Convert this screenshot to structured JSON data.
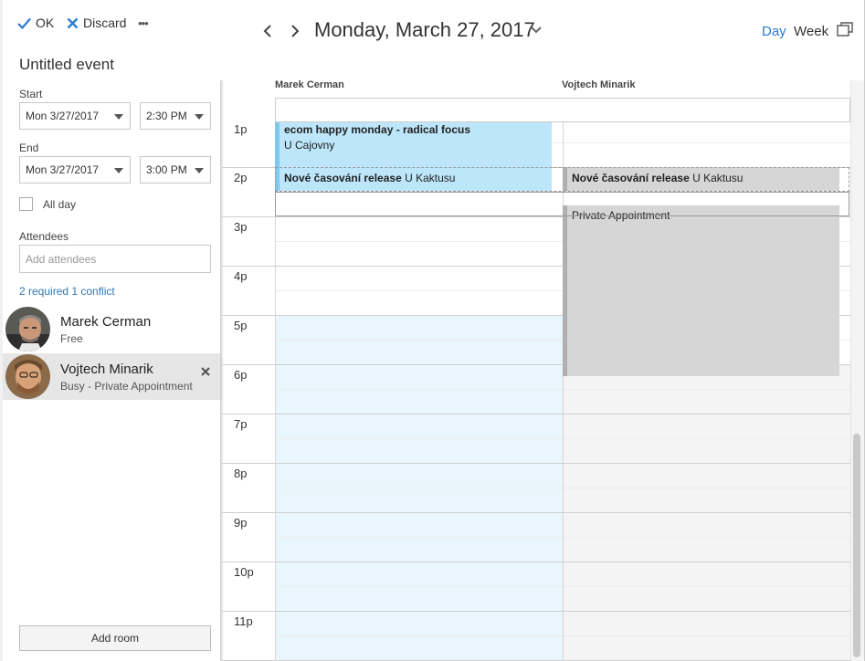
{
  "toolbar": {
    "ok_label": "OK",
    "discard_label": "Discard",
    "more_label": "•••"
  },
  "event": {
    "title": "Untitled event",
    "start_label": "Start",
    "start_date": "Mon 3/27/2017",
    "start_time": "2:30 PM",
    "end_label": "End",
    "end_date": "Mon 3/27/2017",
    "end_time": "3:00 PM",
    "allday_label": "All day"
  },
  "attendees": {
    "label": "Attendees",
    "placeholder": "Add attendees",
    "summary": "2 required 1 conflict",
    "people": [
      {
        "name": "Marek Cerman",
        "status": "Free"
      },
      {
        "name": "Vojtech Minarik",
        "status": "Busy - Private Appointment"
      }
    ]
  },
  "add_room_label": "Add room",
  "calendar": {
    "date_title": "Monday, March 27, 2017",
    "view_day": "Day",
    "view_week": "Week",
    "columns": [
      "Marek Cerman",
      "Vojtech Minarik"
    ],
    "hours": [
      "1p",
      "2p",
      "3p",
      "4p",
      "5p",
      "6p",
      "7p",
      "8p",
      "9p",
      "10p",
      "11p"
    ],
    "events": {
      "ecom_title": "ecom happy monday - radical focus",
      "ecom_location": "U Cajovny",
      "release_title": "Nové časování release",
      "release_location": "U Kaktusu",
      "release2_title": "Nové časování release",
      "release2_location": "U Kaktusu",
      "private_title": "Private Appointment"
    }
  },
  "colors": {
    "accent": "#2b7cd3",
    "ecom_fill": "#bde6fb",
    "ecom_bar": "#7fc9ee",
    "busy_fill": "#d6d6d6",
    "busy_bar": "#b0b0b0",
    "working_hours": "#eaf6fd",
    "offhours": "#f4f4f4"
  }
}
